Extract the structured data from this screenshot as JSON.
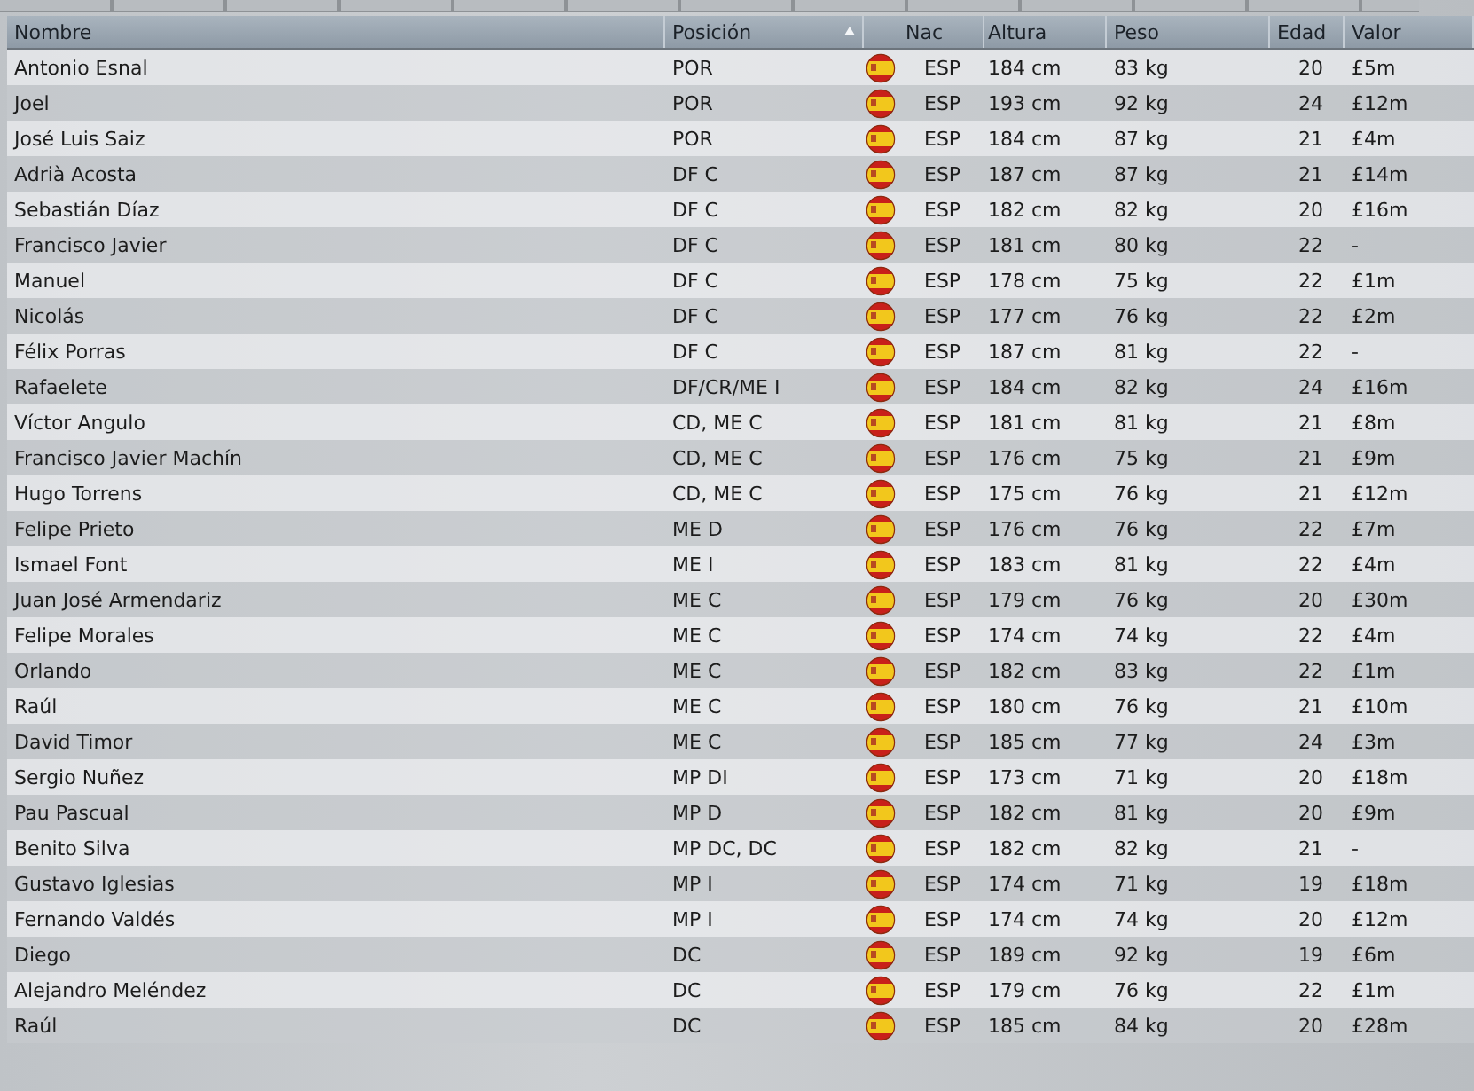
{
  "table": {
    "columns": [
      {
        "label": "Nombre",
        "sorted": false
      },
      {
        "label": "Posición",
        "sorted": true
      },
      {
        "label": "Nac",
        "sorted": false
      },
      {
        "label": "Altura",
        "sorted": false
      },
      {
        "label": "Peso",
        "sorted": false
      },
      {
        "label": "Edad",
        "sorted": false
      },
      {
        "label": "Valor",
        "sorted": false
      }
    ],
    "rows": [
      [
        "Antonio Esnal",
        "POR",
        "ESP",
        "184 cm",
        "83 kg",
        "20",
        "£5m"
      ],
      [
        "Joel",
        "POR",
        "ESP",
        "193 cm",
        "92 kg",
        "24",
        "£12m"
      ],
      [
        "José Luis Saiz",
        "POR",
        "ESP",
        "184 cm",
        "87 kg",
        "21",
        "£4m"
      ],
      [
        "Adrià Acosta",
        "DF C",
        "ESP",
        "187 cm",
        "87 kg",
        "21",
        "£14m"
      ],
      [
        "Sebastián Díaz",
        "DF C",
        "ESP",
        "182 cm",
        "82 kg",
        "20",
        "£16m"
      ],
      [
        "Francisco Javier",
        "DF C",
        "ESP",
        "181 cm",
        "80 kg",
        "22",
        "-"
      ],
      [
        "Manuel",
        "DF C",
        "ESP",
        "178 cm",
        "75 kg",
        "22",
        "£1m"
      ],
      [
        "Nicolás",
        "DF C",
        "ESP",
        "177 cm",
        "76 kg",
        "22",
        "£2m"
      ],
      [
        "Félix Porras",
        "DF C",
        "ESP",
        "187 cm",
        "81 kg",
        "22",
        "-"
      ],
      [
        "Rafaelete",
        "DF/CR/ME I",
        "ESP",
        "184 cm",
        "82 kg",
        "24",
        "£16m"
      ],
      [
        "Víctor Angulo",
        "CD, ME C",
        "ESP",
        "181 cm",
        "81 kg",
        "21",
        "£8m"
      ],
      [
        "Francisco Javier Machín",
        "CD, ME C",
        "ESP",
        "176 cm",
        "75 kg",
        "21",
        "£9m"
      ],
      [
        "Hugo Torrens",
        "CD, ME C",
        "ESP",
        "175 cm",
        "76 kg",
        "21",
        "£12m"
      ],
      [
        "Felipe Prieto",
        "ME D",
        "ESP",
        "176 cm",
        "76 kg",
        "22",
        "£7m"
      ],
      [
        "Ismael Font",
        "ME I",
        "ESP",
        "183 cm",
        "81 kg",
        "22",
        "£4m"
      ],
      [
        "Juan José Armendariz",
        "ME C",
        "ESP",
        "179 cm",
        "76 kg",
        "20",
        "£30m"
      ],
      [
        "Felipe Morales",
        "ME C",
        "ESP",
        "174 cm",
        "74 kg",
        "22",
        "£4m"
      ],
      [
        "Orlando",
        "ME C",
        "ESP",
        "182 cm",
        "83 kg",
        "22",
        "£1m"
      ],
      [
        "Raúl",
        "ME C",
        "ESP",
        "180 cm",
        "76 kg",
        "21",
        "£10m"
      ],
      [
        "David Timor",
        "ME C",
        "ESP",
        "185 cm",
        "77 kg",
        "24",
        "£3m"
      ],
      [
        "Sergio Nuñez",
        "MP DI",
        "ESP",
        "173 cm",
        "71 kg",
        "20",
        "£18m"
      ],
      [
        "Pau Pascual",
        "MP D",
        "ESP",
        "182 cm",
        "81 kg",
        "20",
        "£9m"
      ],
      [
        "Benito Silva",
        "MP DC, DC",
        "ESP",
        "182 cm",
        "82 kg",
        "21",
        "-"
      ],
      [
        "Gustavo Iglesias",
        "MP I",
        "ESP",
        "174 cm",
        "71 kg",
        "19",
        "£18m"
      ],
      [
        "Fernando Valdés",
        "MP I",
        "ESP",
        "174 cm",
        "74 kg",
        "20",
        "£12m"
      ],
      [
        "Diego",
        "DC",
        "ESP",
        "189 cm",
        "92 kg",
        "19",
        "£6m"
      ],
      [
        "Alejandro Meléndez",
        "DC",
        "ESP",
        "179 cm",
        "76 kg",
        "22",
        "£1m"
      ],
      [
        "Raúl",
        "DC",
        "ESP",
        "185 cm",
        "84 kg",
        "20",
        "£28m"
      ]
    ]
  }
}
